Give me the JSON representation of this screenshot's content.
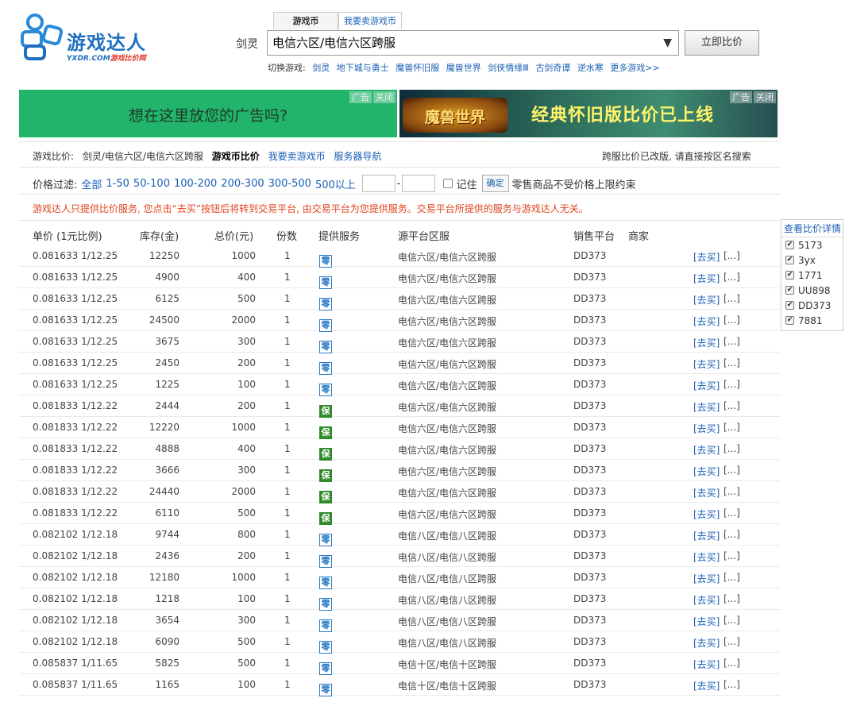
{
  "brand": {
    "name": "游戏达人",
    "site": "YXDR.COM",
    "site_suffix": "游戏比价网"
  },
  "tabs": [
    {
      "label": "游戏币"
    },
    {
      "label": "我要卖游戏币"
    }
  ],
  "search": {
    "game_label": "剑灵",
    "selected_server": "电信六区/电信六区跨服",
    "compare_button": "立即比价"
  },
  "switch_games": {
    "label": "切换游戏:",
    "games": [
      "剑灵",
      "地下城与勇士",
      "魔兽怀旧服",
      "魔兽世界",
      "剑侠情缘Ⅲ",
      "古剑奇谭",
      "逆水寒",
      "更多游戏>>"
    ]
  },
  "ads": {
    "left_text": "想在这里放您的广告吗?",
    "right_logo": "魔兽世界",
    "right_text": "经典怀旧版比价已上线",
    "tag_ad": "广告",
    "tag_close": "关闭"
  },
  "breadcrumb": {
    "label": "游戏比价:",
    "path": "剑灵/电信六区/电信六区跨服",
    "current": "游戏币比价",
    "links": [
      "我要卖游戏币",
      "服务器导航"
    ],
    "right_note": "跨服比价已改版, 请直接按区名搜索"
  },
  "filter": {
    "label": "价格过滤:",
    "options": [
      "全部",
      "1-50",
      "50-100",
      "100-200",
      "200-300",
      "300-500",
      "500以上"
    ],
    "remember": "记住",
    "confirm": "确定",
    "note": "零售商品不受价格上限约束"
  },
  "disclaimer": "游戏达人只提供比价服务, 您点击“去买”按钮后将转到交易平台, 由交易平台为您提供服务。交易平台所提供的服务与游戏达人无关。",
  "table": {
    "headers": {
      "price": "单价 (1元比例)",
      "stock": "库存(金)",
      "total": "总价(元)",
      "qty": "份数",
      "service": "提供服务",
      "source": "源平台区服",
      "platform": "销售平台",
      "merchant": "商家"
    },
    "buy_label": "[去买]",
    "more_label": "[...]",
    "badges": {
      "shang": "商",
      "ling": "零",
      "bao": "保"
    },
    "rows": [
      {
        "price": "0.081633 1/12.25",
        "stock": "12250",
        "total": "1000",
        "qty": "1",
        "svc": "sl",
        "src": "电信六区/电信六区跨服",
        "plat": "DD373"
      },
      {
        "price": "0.081633 1/12.25",
        "stock": "4900",
        "total": "400",
        "qty": "1",
        "svc": "sl",
        "src": "电信六区/电信六区跨服",
        "plat": "DD373"
      },
      {
        "price": "0.081633 1/12.25",
        "stock": "6125",
        "total": "500",
        "qty": "1",
        "svc": "sl",
        "src": "电信六区/电信六区跨服",
        "plat": "DD373"
      },
      {
        "price": "0.081633 1/12.25",
        "stock": "24500",
        "total": "2000",
        "qty": "1",
        "svc": "sl",
        "src": "电信六区/电信六区跨服",
        "plat": "DD373"
      },
      {
        "price": "0.081633 1/12.25",
        "stock": "3675",
        "total": "300",
        "qty": "1",
        "svc": "sl",
        "src": "电信六区/电信六区跨服",
        "plat": "DD373"
      },
      {
        "price": "0.081633 1/12.25",
        "stock": "2450",
        "total": "200",
        "qty": "1",
        "svc": "sl",
        "src": "电信六区/电信六区跨服",
        "plat": "DD373"
      },
      {
        "price": "0.081633 1/12.25",
        "stock": "1225",
        "total": "100",
        "qty": "1",
        "svc": "sl",
        "src": "电信六区/电信六区跨服",
        "plat": "DD373"
      },
      {
        "price": "0.081833 1/12.22",
        "stock": "2444",
        "total": "200",
        "qty": "1",
        "svc": "b",
        "src": "电信六区/电信六区跨服",
        "plat": "DD373"
      },
      {
        "price": "0.081833 1/12.22",
        "stock": "12220",
        "total": "1000",
        "qty": "1",
        "svc": "b",
        "src": "电信六区/电信六区跨服",
        "plat": "DD373"
      },
      {
        "price": "0.081833 1/12.22",
        "stock": "4888",
        "total": "400",
        "qty": "1",
        "svc": "b",
        "src": "电信六区/电信六区跨服",
        "plat": "DD373"
      },
      {
        "price": "0.081833 1/12.22",
        "stock": "3666",
        "total": "300",
        "qty": "1",
        "svc": "b",
        "src": "电信六区/电信六区跨服",
        "plat": "DD373"
      },
      {
        "price": "0.081833 1/12.22",
        "stock": "24440",
        "total": "2000",
        "qty": "1",
        "svc": "b",
        "src": "电信六区/电信六区跨服",
        "plat": "DD373"
      },
      {
        "price": "0.081833 1/12.22",
        "stock": "6110",
        "total": "500",
        "qty": "1",
        "svc": "b",
        "src": "电信六区/电信六区跨服",
        "plat": "DD373"
      },
      {
        "price": "0.082102 1/12.18",
        "stock": "9744",
        "total": "800",
        "qty": "1",
        "svc": "sl",
        "src": "电信八区/电信八区跨服",
        "plat": "DD373"
      },
      {
        "price": "0.082102 1/12.18",
        "stock": "2436",
        "total": "200",
        "qty": "1",
        "svc": "sl",
        "src": "电信八区/电信八区跨服",
        "plat": "DD373"
      },
      {
        "price": "0.082102 1/12.18",
        "stock": "12180",
        "total": "1000",
        "qty": "1",
        "svc": "sl",
        "src": "电信八区/电信八区跨服",
        "plat": "DD373"
      },
      {
        "price": "0.082102 1/12.18",
        "stock": "1218",
        "total": "100",
        "qty": "1",
        "svc": "sl",
        "src": "电信八区/电信八区跨服",
        "plat": "DD373"
      },
      {
        "price": "0.082102 1/12.18",
        "stock": "3654",
        "total": "300",
        "qty": "1",
        "svc": "sl",
        "src": "电信八区/电信八区跨服",
        "plat": "DD373"
      },
      {
        "price": "0.082102 1/12.18",
        "stock": "6090",
        "total": "500",
        "qty": "1",
        "svc": "sl",
        "src": "电信八区/电信八区跨服",
        "plat": "DD373"
      },
      {
        "price": "0.085837 1/11.65",
        "stock": "5825",
        "total": "500",
        "qty": "1",
        "svc": "sl",
        "src": "电信十区/电信十区跨服",
        "plat": "DD373"
      },
      {
        "price": "0.085837 1/11.65",
        "stock": "1165",
        "total": "100",
        "qty": "1",
        "svc": "sl",
        "src": "电信十区/电信十区跨服",
        "plat": "DD373"
      }
    ]
  },
  "side_panel": {
    "title": "查看比价详情",
    "platforms": [
      "5173",
      "3yx",
      "1771",
      "UU898",
      "DD373",
      "7881"
    ]
  }
}
